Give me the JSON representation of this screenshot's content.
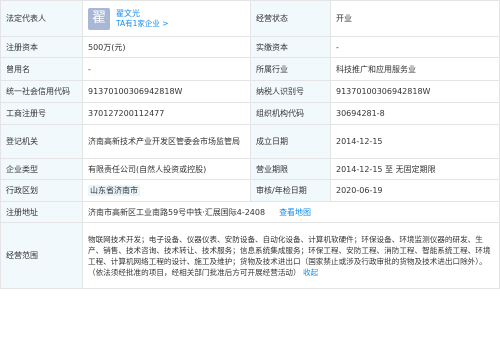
{
  "legal_rep": {
    "label": "法定代表人",
    "avatar_char": "翟",
    "name": "翟文光",
    "enterprises": "TA有1家企业 >"
  },
  "status": {
    "label": "经营状态",
    "value": "开业"
  },
  "reg_capital": {
    "label": "注册资本",
    "value": "500万(元)"
  },
  "paid_capital": {
    "label": "实缴资本",
    "value": "-"
  },
  "former_name": {
    "label": "曾用名",
    "value": "-"
  },
  "industry": {
    "label": "所属行业",
    "value": "科技推广和应用服务业"
  },
  "credit_code": {
    "label": "统一社会信用代码",
    "value": "91370100306942818W"
  },
  "taxpayer_id": {
    "label": "纳税人识别号",
    "value": "91370100306942818W"
  },
  "reg_number": {
    "label": "工商注册号",
    "value": "370127200112477"
  },
  "org_code": {
    "label": "组织机构代码",
    "value": "30694281-8"
  },
  "authority": {
    "label": "登记机关",
    "value": "济南高新技术产业开发区管委会市场监管局"
  },
  "established": {
    "label": "成立日期",
    "value": "2014-12-15"
  },
  "company_type": {
    "label": "企业类型",
    "value": "有限责任公司(自然人投资或控股)"
  },
  "business_term": {
    "label": "营业期限",
    "value": "2014-12-15 至 无固定期限"
  },
  "region": {
    "label": "行政区划",
    "value": "山东省济南市"
  },
  "approval_date": {
    "label": "审核/年检日期",
    "value": "2020-06-19"
  },
  "address": {
    "label": "注册地址",
    "value": "济南市高新区工业南路59号中铁·汇展国际4-2408",
    "map_link": "查看地图"
  },
  "scope": {
    "label": "经营范围",
    "value": "物联网技术开发；电子设备、仪器仪表、安防设备、自动化设备、计算机软硬件；环保设备、环境监测仪器的研发、生产、销售、技术咨询、技术转让、技术服务；信息系统集成服务；环保工程、安防工程、消防工程、智能系统工程、环境工程、计算机网络工程的设计、施工及维护；货物及技术进出口（国家禁止或涉及行政审批的货物及技术进出口除外）。（依法须经批准的项目，经相关部门批准后方可开展经营活动）",
    "collapse": "收起"
  }
}
